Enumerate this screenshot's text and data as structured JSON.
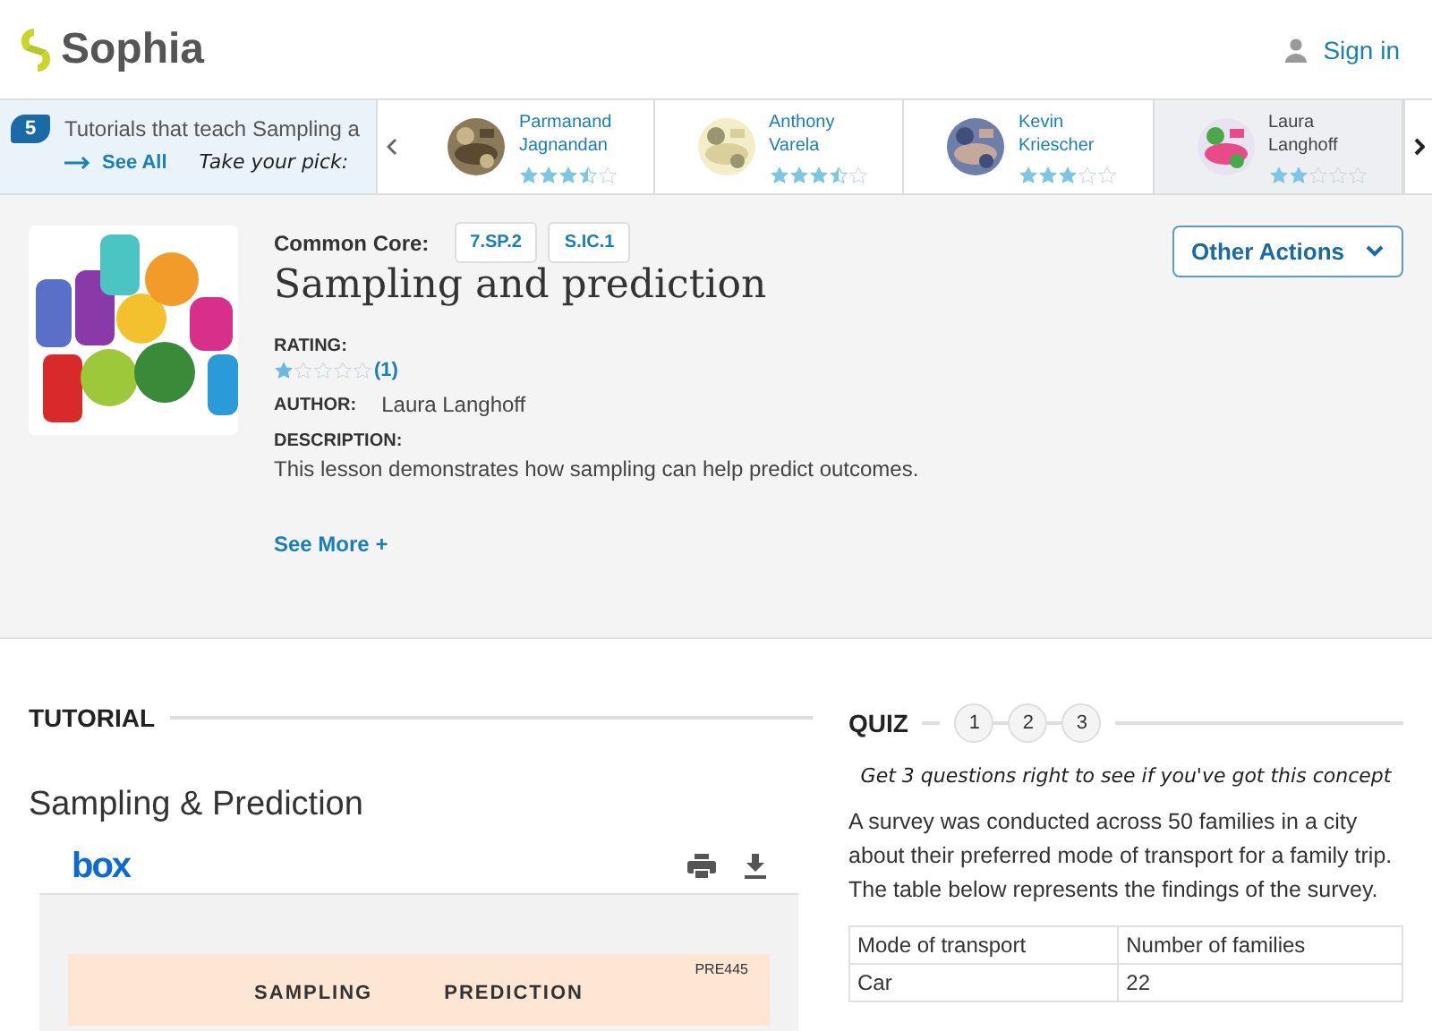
{
  "header": {
    "logo": "Sophia",
    "sign_in": "Sign in"
  },
  "carousel": {
    "count": "5",
    "title": "Tutorials that teach Sampling a",
    "see_all": "See All",
    "pick": "Take your pick:",
    "tutors": [
      {
        "name": "Parmanand Jagnandan",
        "stars": 3.5,
        "selected": false
      },
      {
        "name": "Anthony Varela",
        "stars": 3.5,
        "selected": false
      },
      {
        "name": "Kevin Kriescher",
        "stars": 3,
        "selected": false
      },
      {
        "name": "Laura Langhoff",
        "stars": 2,
        "selected": true
      }
    ]
  },
  "lesson": {
    "standards_label": "Common Core:",
    "standards": [
      "7.SP.2",
      "S.IC.1"
    ],
    "title": "Sampling and prediction",
    "actions": "Other Actions",
    "rating_label": "RATING:",
    "stars": 1,
    "rating_count": "(1)",
    "author_label": "AUTHOR:",
    "author": "Laura Langhoff",
    "description_label": "DESCRIPTION:",
    "description": "This lesson demonstrates how sampling can help predict outcomes.",
    "see_more": "See More +"
  },
  "tutorial": {
    "heading": "TUTORIAL",
    "title": "Sampling & Prediction",
    "viewer_logo": "box",
    "doc_code": "PRE445",
    "doc_title": [
      "SAMPLING",
      "PREDICTION"
    ]
  },
  "quiz": {
    "heading": "QUIZ",
    "steps": [
      {
        "label": "1",
        "selected": false
      },
      {
        "label": "2",
        "selected": false
      },
      {
        "label": "3",
        "selected": false
      }
    ],
    "prompt": "Get 3 questions right to see if you've got this concept",
    "question": "A survey was conducted across 50 families in a city about their preferred mode of transport for a family trip. The table below represents the findings of the survey.",
    "table": {
      "columns": [
        "Mode of transport",
        "Number of families"
      ],
      "rows": [
        [
          "Car",
          "22"
        ]
      ]
    }
  }
}
